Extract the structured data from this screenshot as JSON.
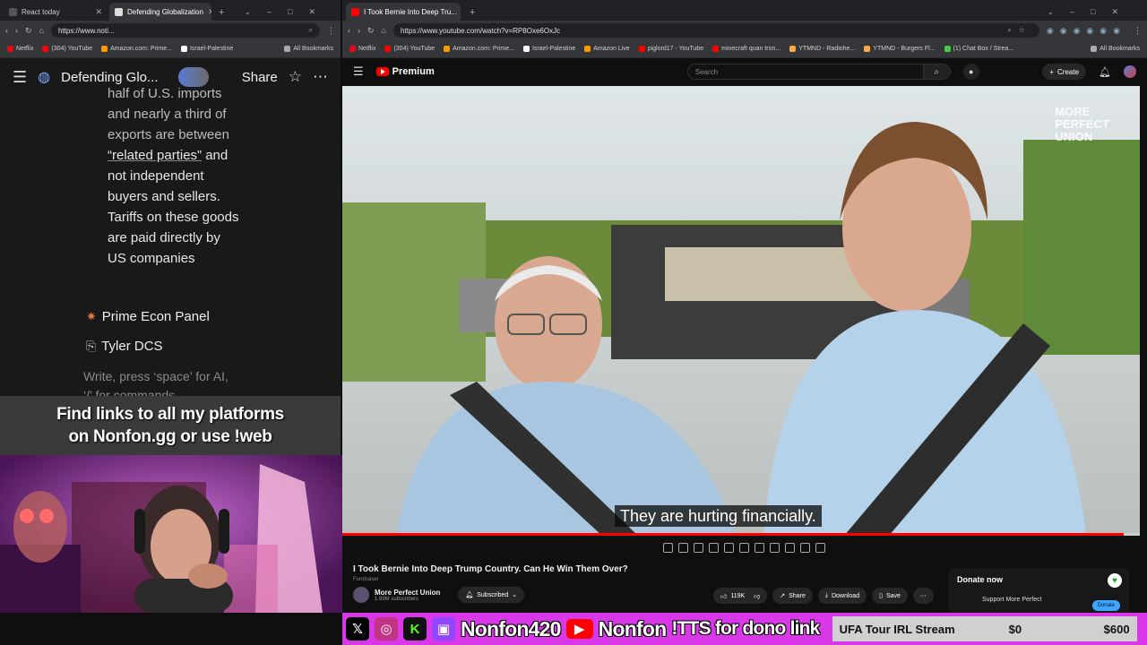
{
  "left_browser": {
    "tabs": [
      {
        "label": "React today",
        "active": false
      },
      {
        "label": "Defending Globalization",
        "active": true
      }
    ],
    "url": "https://www.noti...",
    "bookmarks": [
      "Netflix",
      "(304) YouTube",
      "Amazon.com: Prime...",
      "Israel-Palestine",
      "All Bookmarks"
    ],
    "page_title": "Defending Glo...",
    "share_label": "Share",
    "body_lines": [
      "half of U.S. imports",
      "and nearly a third of",
      "exports are between"
    ],
    "related_parties": "“related parties”",
    "after_link": " and",
    "body_lines2": [
      "not independent",
      "buyers and sellers.",
      "Tariffs on these goods",
      "are paid directly by",
      "US companies"
    ],
    "subpages": [
      {
        "label": "Prime Econ Panel",
        "icon": "sparkle-icon"
      },
      {
        "label": "Tyler DCS",
        "icon": "page-link-icon"
      }
    ],
    "placeholder": "Write, press ‘space’ for AI,",
    "placeholder2": "‘/’ for commands..."
  },
  "overlay": {
    "line1": "Find links to all my platforms",
    "line2": "on Nonfon.gg or use !web"
  },
  "right_browser": {
    "tab_label": "I Took Bernie Into Deep Tru...",
    "url": "https://www.youtube.com/watch?v=RP8Oxe6OxJc",
    "bookmarks": [
      "Netflix",
      "(304) YouTube",
      "Amazon.com: Prime...",
      "Israel-Palestine",
      "Amazon Live",
      "piglord17 - YouTube",
      "minecraft quan tron...",
      "YTMND - Radiohe...",
      "YTMND - Burgers Fl...",
      "(1) Chat Box / Strea...",
      "All Bookmarks"
    ]
  },
  "youtube": {
    "logo": "Premium",
    "search_placeholder": "Search",
    "create_label": "Create",
    "caption": "They are hurting financially.",
    "watermark": [
      "MORE",
      "PERFECT",
      "UNION"
    ],
    "progress": 0.98,
    "title": "I Took Bernie Into Deep Trump Country. Can He Win Them Over?",
    "fundraiser": "Fundraiser",
    "channel": "More Perfect Union",
    "subscribers": "1.99M subscribers",
    "subscribed_label": "Subscribed",
    "likes": "119K",
    "share_label": "Share",
    "download_label": "Download",
    "save_label": "Save",
    "donate_title": "Donate now",
    "donate_support": "Support More Perfect",
    "donate_btn": "Donate"
  },
  "stream_bar": {
    "handle1": "Nonfon420",
    "handle2": "Nonfon",
    "tts": "!TTS for dono link",
    "goal_label": "UFA Tour IRL Stream",
    "goal_current": "$0",
    "goal_target": "$600",
    "colors": {
      "bar": "#d838e8",
      "x": "#000000",
      "instagram": "#c13584",
      "kick": "#53fc18",
      "twitch": "#9146ff",
      "youtube": "#ff0000"
    }
  }
}
